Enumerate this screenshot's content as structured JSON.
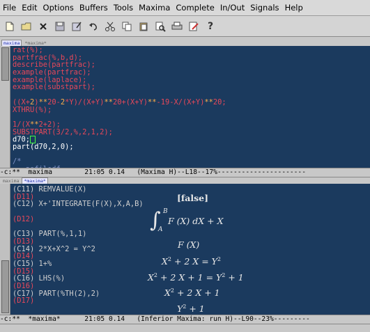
{
  "colors": {
    "pane_bg": "#1b3a5e",
    "red": "#e8485a",
    "orange": "#ffae4a",
    "white": "#ffffff",
    "comment": "#7f93c8",
    "green": "#44ff44",
    "dim": "#d0d0d0"
  },
  "menu": [
    "File",
    "Edit",
    "Options",
    "Buffers",
    "Tools",
    "Maxima",
    "Complete",
    "In/Out",
    "Signals",
    "Help"
  ],
  "toolbar_icons": [
    "new-file-icon",
    "open-folder-icon",
    "close-x-icon",
    "save-disk-icon",
    "save-as-icon",
    "undo-icon",
    "cut-icon",
    "copy-icon",
    "paste-icon",
    "search-icon",
    "print-icon",
    "preferences-icon",
    "help-icon"
  ],
  "top_tabs": {
    "active": "maxima",
    "inactive": "*maxima*"
  },
  "bottom_tabs": {
    "inactive": "maxima",
    "active": "*maxima*"
  },
  "top_lines": [
    [
      {
        "t": "rat(%);",
        "c": "red"
      }
    ],
    [
      {
        "t": "partfrac(%,b,d);",
        "c": "red"
      }
    ],
    [
      {
        "t": "describe(partfrac);",
        "c": "red"
      }
    ],
    [
      {
        "t": "example(partfrac);",
        "c": "red"
      }
    ],
    [
      {
        "t": "example(laplace);",
        "c": "red"
      }
    ],
    [
      {
        "t": "example(substpart);",
        "c": "red"
      }
    ],
    [
      {
        "t": "",
        "c": "white"
      }
    ],
    [
      {
        "t": "((X+",
        "c": "red"
      },
      {
        "t": "2",
        "c": "orange"
      },
      {
        "t": ")",
        "c": "red"
      },
      {
        "t": "**",
        "c": "orange"
      },
      {
        "t": "20-",
        "c": "red"
      },
      {
        "t": "2",
        "c": "orange"
      },
      {
        "t": "*Y)/(X+Y)",
        "c": "red"
      },
      {
        "t": "**",
        "c": "orange"
      },
      {
        "t": "20+(X+Y)",
        "c": "red"
      },
      {
        "t": "**",
        "c": "orange"
      },
      {
        "t": "-19-X/(X+Y)",
        "c": "red"
      },
      {
        "t": "**",
        "c": "orange"
      },
      {
        "t": "20;",
        "c": "red"
      }
    ],
    [
      {
        "t": "XTHRU(%);",
        "c": "red"
      }
    ],
    [
      {
        "t": "",
        "c": "white"
      }
    ],
    [
      {
        "t": "1/(X",
        "c": "red"
      },
      {
        "t": "**",
        "c": "orange"
      },
      {
        "t": "2+2);",
        "c": "red"
      }
    ],
    [
      {
        "t": "SUBSTPART(3/2,%,2,1,2);",
        "c": "red"
      }
    ],
    [
      {
        "t": "d70;",
        "c": "white"
      },
      {
        "t": "",
        "c": "cursor"
      }
    ],
    [
      {
        "t": "part(d70,2,0);",
        "c": "white"
      }
    ],
    [
      {
        "t": "",
        "c": "white"
      }
    ],
    [
      {
        "t": "/*",
        "c": "comment"
      }
    ],
    [
      {
        "t": "   asfiledf",
        "c": "comment"
      }
    ]
  ],
  "top_modeline": "-c:**  maxima        21:05 0.14   (Maxima H)--L18--17%----------------------",
  "bottom_lines": [
    [
      {
        "t": "(C11) REMVALUE(X)",
        "c": "dim"
      }
    ],
    [
      {
        "t": "(D11)",
        "c": "red"
      }
    ],
    [
      {
        "t": "(C12) X+'INTEGRATE(F(X),X,A,B)",
        "c": "dim"
      }
    ],
    [
      {
        "t": "",
        "c": "white"
      }
    ],
    [
      {
        "t": "(D12)",
        "c": "red"
      }
    ],
    [
      {
        "t": "",
        "c": "white"
      }
    ],
    [
      {
        "t": "(C13) PART(%,1,1)",
        "c": "dim"
      }
    ],
    [
      {
        "t": "(D13)",
        "c": "red"
      }
    ],
    [
      {
        "t": "(C14) 2*X+X^2 = Y^2",
        "c": "dim"
      }
    ],
    [
      {
        "t": "(D14)",
        "c": "red"
      }
    ],
    [
      {
        "t": "(C15) 1+%",
        "c": "dim"
      }
    ],
    [
      {
        "t": "(D15)",
        "c": "red"
      }
    ],
    [
      {
        "t": "(C16) LHS(%)",
        "c": "dim"
      }
    ],
    [
      {
        "t": "(D16)",
        "c": "red"
      }
    ],
    [
      {
        "t": "(C17) PART(%TH(2),2)",
        "c": "dim"
      }
    ],
    [
      {
        "t": "(D17)",
        "c": "red"
      }
    ]
  ],
  "tex": {
    "false_label": "[false]",
    "integral_upper": "B",
    "integral_lower": "A",
    "integrand": "F (X)  dX + X",
    "fx": "F (X)",
    "eq14_lhs": "X",
    "eq14_mid": " + 2 X = Y",
    "eq15_lhs": "X",
    "eq15_mid": " + 2 X + 1 = Y",
    "eq15_tail": " + 1",
    "eq16_lhs": "X",
    "eq16_mid": " + 2 X + 1",
    "eq17_lhs": "Y",
    "eq17_tail": " + 1",
    "exp": "2"
  },
  "bottom_modeline": "-c:**  *maxima*      21:05 0.14   (Inferior Maxima: run H)--L90--23%---------"
}
